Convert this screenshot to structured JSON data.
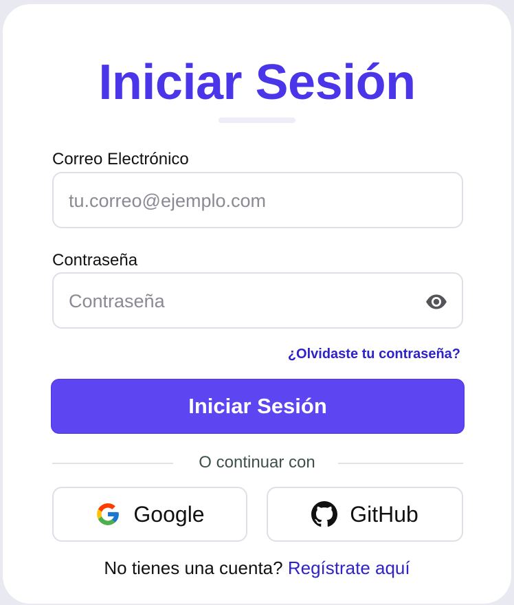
{
  "login": {
    "title": "Iniciar Sesión",
    "email": {
      "label": "Correo Electrónico",
      "placeholder": "tu.correo@ejemplo.com",
      "value": ""
    },
    "password": {
      "label": "Contraseña",
      "placeholder": "Contraseña",
      "value": "",
      "toggle_icon": "eye-icon"
    },
    "forgot_link": "¿Olvidaste tu contraseña?",
    "submit_label": "Iniciar Sesión",
    "divider_text": "O continuar con",
    "social": [
      {
        "label": "Google",
        "icon": "google-icon"
      },
      {
        "label": "GitHub",
        "icon": "github-icon"
      }
    ],
    "signup_prompt": "No tienes una cuenta?",
    "signup_link": "Regístrate aquí"
  },
  "colors": {
    "accent": "#5e45f2",
    "title": "#4a35e8",
    "link": "#2f22c9",
    "border": "#dfdfe7"
  }
}
